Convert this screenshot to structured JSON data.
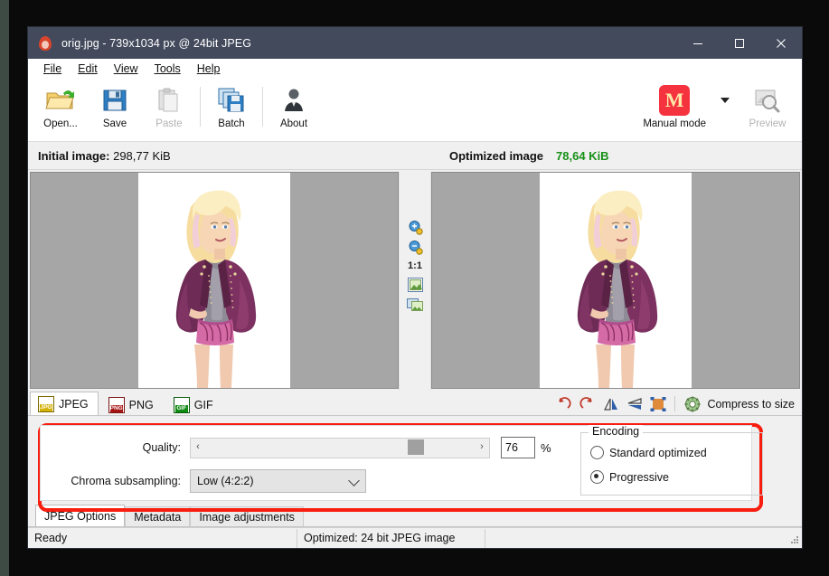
{
  "window": {
    "title": "orig.jpg - 739x1034 px @ 24bit JPEG",
    "icon": "riot-flame-icon",
    "minimize": "–",
    "maximize": "□",
    "close": "✕"
  },
  "menubar": [
    {
      "label": "File",
      "accesskey": "F"
    },
    {
      "label": "Edit",
      "accesskey": "E"
    },
    {
      "label": "View",
      "accesskey": "V"
    },
    {
      "label": "Tools",
      "accesskey": "T"
    },
    {
      "label": "Help",
      "accesskey": "H"
    }
  ],
  "toolbar": {
    "open_label": "Open...",
    "save_label": "Save",
    "paste_label": "Paste",
    "batch_label": "Batch",
    "about_label": "About",
    "mode_badge": "M",
    "mode_label": "Manual mode",
    "preview_label": "Preview"
  },
  "sizebar": {
    "initial_label": "Initial image:",
    "initial_value": "298,77 KiB",
    "optimized_label": "Optimized image",
    "optimized_value": "78,64 KiB",
    "optimized_color": "#189018"
  },
  "preview": {
    "zoom_in": "zoom-in-icon",
    "zoom_out": "zoom-out-icon",
    "one_to_one": "1:1",
    "fit_icon": "fit-to-window-icon",
    "compare_icon": "compare-side-by-side-icon"
  },
  "format_tabs": [
    {
      "label": "JPEG",
      "badge": "JPG",
      "badge_color": "#d4b206",
      "active": true
    },
    {
      "label": "PNG",
      "badge": "PNG",
      "badge_color": "#a81414",
      "active": false
    },
    {
      "label": "GIF",
      "badge": "GIF",
      "badge_color": "#0f8a12",
      "active": false
    }
  ],
  "format_tools": {
    "rotate_left": "rotate-left-icon",
    "rotate_right": "rotate-right-icon",
    "flip_horizontal": "flip-horizontal-icon",
    "flip_vertical": "flip-vertical-icon",
    "resize": "resize-icon",
    "compress_icon": "gear-icon",
    "compress_label": "Compress to size"
  },
  "options": {
    "quality_label": "Quality:",
    "quality_value": "76",
    "quality_percent": "%",
    "slider_left_arrow": "‹",
    "slider_right_arrow": "›",
    "chroma_label": "Chroma subsampling:",
    "chroma_value": "Low (4:2:2)",
    "encoding_title": "Encoding",
    "encoding_option_1": "Standard optimized",
    "encoding_option_2": "Progressive",
    "encoding_selected": "Progressive",
    "highlight_color": "#f81d0e"
  },
  "bottom_tabs": [
    {
      "label": "JPEG Options",
      "active": true
    },
    {
      "label": "Metadata",
      "active": false
    },
    {
      "label": "Image adjustments",
      "active": false
    }
  ],
  "statusbar": {
    "state": "Ready",
    "info": "Optimized: 24 bit JPEG image"
  }
}
